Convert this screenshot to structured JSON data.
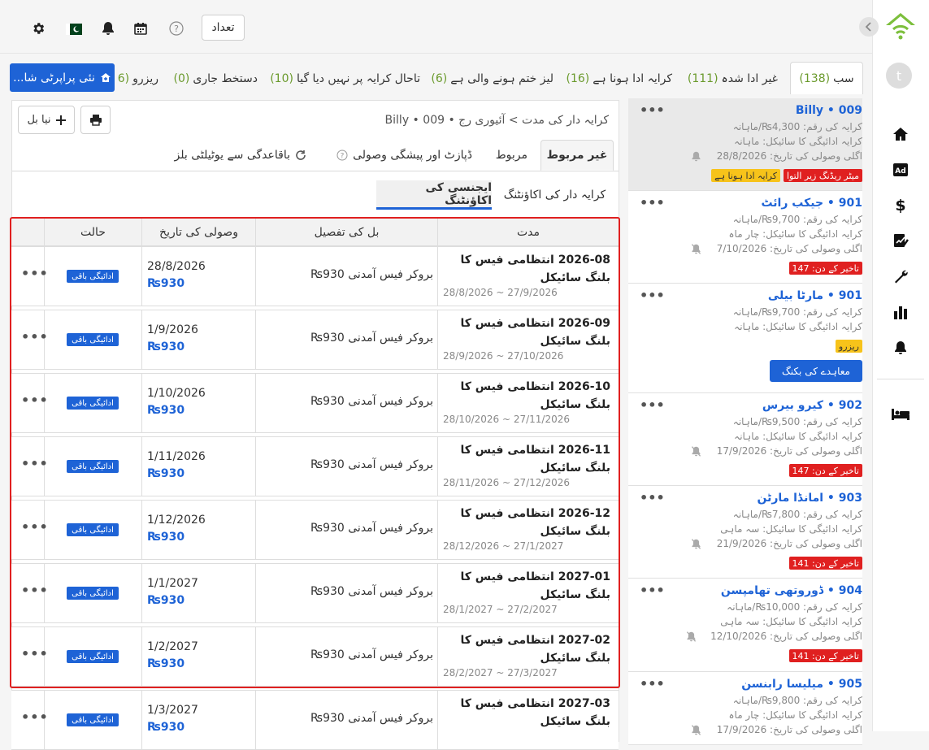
{
  "topbar": {
    "count_label": "تعداد"
  },
  "filter_tabs": [
    {
      "label": "سب",
      "count": "(138)"
    },
    {
      "label": "غیر ادا شدہ",
      "count": "(111)"
    },
    {
      "label": "کرایہ ادا ہونا ہے",
      "count": "(16)"
    },
    {
      "label": "لیز ختم ہونے والی ہے",
      "count": "(6)"
    },
    {
      "label": "تاحال کرایہ پر نہیں دیا گیا",
      "count": "(10)"
    },
    {
      "label": "دستخط جاری",
      "count": "(0)"
    },
    {
      "label": "ریزرو",
      "count": "(6"
    }
  ],
  "new_property_label": "نئی پراپرٹی شا...",
  "breadcrumb": "کرایہ دار کی مدت >  آئیوری رج • 009 • Billy",
  "new_bill_label": "نیا بل",
  "panel_tabs": {
    "unlinked": "غیر مربوط",
    "linked": "مربوط",
    "deposit": "ڈپازٹ اور پیشگی وصولی",
    "utility": "باقاعدگی سے یوٹیلٹی بلز"
  },
  "sub_tabs": {
    "tenant": "کرایہ دار کی اکاؤنٹنگ",
    "agency": "ایجنسی کی اکاؤنٹنگ"
  },
  "table": {
    "headers": {
      "period": "مدت",
      "detail": "بل کی تفصیل",
      "due_date": "وصولی کی تاریخ",
      "status": "حالت"
    },
    "rows": [
      {
        "title": "2026-08 انتظامی فیس کا بلنگ سائیکل",
        "range": "28/8/2026 ~ 27/9/2026",
        "fee": "بروکر فیس آمدنی  930₨",
        "date": "28/8/2026",
        "amount": "₨930",
        "status": "ادائیگی باقی"
      },
      {
        "title": "2026-09 انتظامی فیس کا بلنگ سائیکل",
        "range": "28/9/2026 ~ 27/10/2026",
        "fee": "بروکر فیس آمدنی  930₨",
        "date": "1/9/2026",
        "amount": "₨930",
        "status": "ادائیگی باقی"
      },
      {
        "title": "2026-10 انتظامی فیس کا بلنگ سائیکل",
        "range": "28/10/2026 ~ 27/11/2026",
        "fee": "بروکر فیس آمدنی  930₨",
        "date": "1/10/2026",
        "amount": "₨930",
        "status": "ادائیگی باقی"
      },
      {
        "title": "2026-11 انتظامی فیس کا بلنگ سائیکل",
        "range": "28/11/2026 ~ 27/12/2026",
        "fee": "بروکر فیس آمدنی  930₨",
        "date": "1/11/2026",
        "amount": "₨930",
        "status": "ادائیگی باقی"
      },
      {
        "title": "2026-12 انتظامی فیس کا بلنگ سائیکل",
        "range": "28/12/2026 ~ 27/1/2027",
        "fee": "بروکر فیس آمدنی  930₨",
        "date": "1/12/2026",
        "amount": "₨930",
        "status": "ادائیگی باقی"
      },
      {
        "title": "2027-01 انتظامی فیس کا بلنگ سائیکل",
        "range": "28/1/2027 ~ 27/2/2027",
        "fee": "بروکر فیس آمدنی  930₨",
        "date": "1/1/2027",
        "amount": "₨930",
        "status": "ادائیگی باقی"
      },
      {
        "title": "2027-02 انتظامی فیس کا بلنگ سائیکل",
        "range": "28/2/2027 ~ 27/3/2027",
        "fee": "بروکر فیس آمدنی  930₨",
        "date": "1/2/2027",
        "amount": "₨930",
        "status": "ادائیگی باقی"
      },
      {
        "title": "2027-03 انتظامی فیس کا بلنگ سائیکل",
        "range": "",
        "fee": "بروکر فیس آمدنی  930₨",
        "date": "1/3/2027",
        "amount": "₨930",
        "status": "ادائیگی باقی"
      }
    ]
  },
  "tenants": [
    {
      "unit": "009",
      "name": "Billy",
      "rent": "کرایہ کی رقم: 4,300₨/ماہانہ",
      "cycle": "کرایہ ادائیگی کا سائیکل: ماہانہ",
      "next": "اگلی وصولی کی تاریخ:  28/8/2026",
      "tag1": "کرایہ ادا ہونا ہے",
      "tag2": "میٹر ریڈنگ زیر التوا"
    },
    {
      "unit": "901",
      "name": "جیکب رائٹ",
      "rent": "کرایہ کی رقم: 9,700₨/ماہانہ",
      "cycle": "کرایہ ادائیگی کا سائیکل: چار ماہ",
      "next": "اگلی وصولی کی تاریخ:  7/10/2026",
      "late": "تاخیر کے دن: 147"
    },
    {
      "unit": "901",
      "name": "مارٹا بیلی",
      "rent": "کرایہ کی رقم: 9,700₨/ماہانہ",
      "cycle": "کرایہ ادائیگی کا سائیکل: ماہانہ",
      "tag1": "ریزرو",
      "button": "معاہدے کی بکنگ"
    },
    {
      "unit": "902",
      "name": "کیرو بیرس",
      "rent": "کرایہ کی رقم: 9,500₨/ماہانہ",
      "cycle": "کرایہ ادائیگی کا سائیکل: ماہانہ",
      "next": "اگلی وصولی کی تاریخ:  17/9/2026",
      "late": "تاخیر کے دن: 147"
    },
    {
      "unit": "903",
      "name": "امانڈا مارٹن",
      "rent": "کرایہ کی رقم: 7,800₨/ماہانہ",
      "cycle": "کرایہ ادائیگی کا سائیکل: سہ ماہی",
      "next": "اگلی وصولی کی تاریخ:  21/9/2026",
      "late": "تاخیر کے دن: 141"
    },
    {
      "unit": "904",
      "name": "ڈوروتھی تھامپسن",
      "rent": "کرایہ کی رقم: 10,000₨/ماہانہ",
      "cycle": "کرایہ ادائیگی کا سائیکل: سہ ماہی",
      "next": "اگلی وصولی کی تاریخ:  12/10/2026",
      "late": "تاخیر کے دن: 141"
    },
    {
      "unit": "905",
      "name": "میلیسا رابنسن",
      "rent": "کرایہ کی رقم: 9,800₨/ماہانہ",
      "cycle": "کرایہ ادائیگی کا سائیکل: چار ماہ",
      "next": "اگلی وصولی کی تاریخ:  17/9/2026"
    }
  ],
  "colors": {
    "accent": "#1e63d6",
    "highlight_border": "#e02020",
    "count_green": "#6a9a2c",
    "late_red": "#e02020",
    "tag_yellow": "#f7c31a"
  },
  "avatar_letter": "t"
}
